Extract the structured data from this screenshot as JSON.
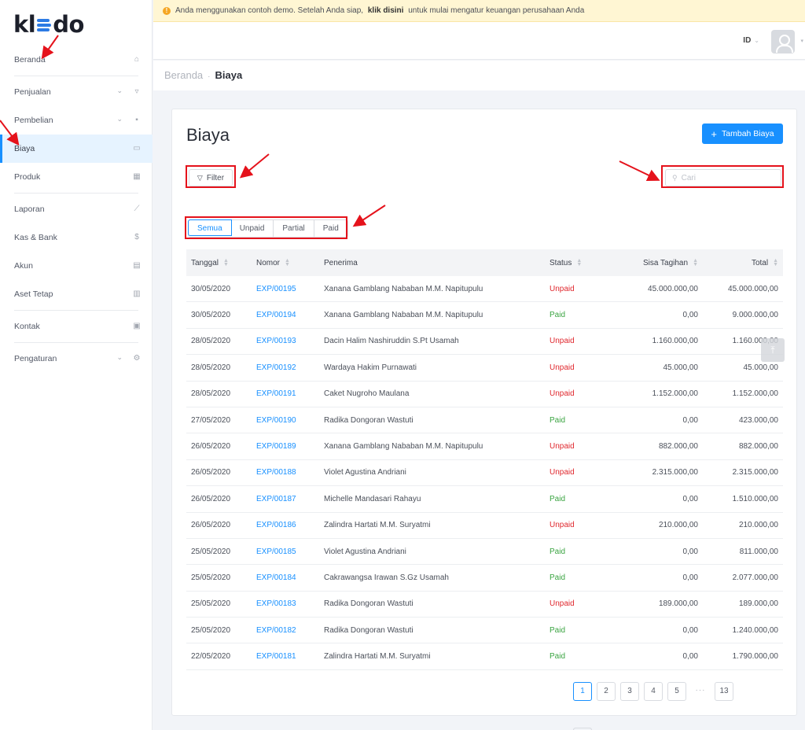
{
  "brand": {
    "logo_text_left": "kl",
    "logo_text_right": "do"
  },
  "banner": {
    "text_before": "Anda menggunakan contoh demo. Setelah Anda siap, ",
    "link_text": "klik disini",
    "text_after": " untuk mulai mengatur keuangan perusahaan Anda"
  },
  "header": {
    "language": "ID"
  },
  "sidebar": {
    "items": [
      {
        "label": "Beranda",
        "icon": "home-icon"
      },
      {
        "label": "Penjualan",
        "icon": "basket-icon"
      },
      {
        "label": "Pembelian",
        "icon": "bag-icon"
      },
      {
        "label": "Biaya",
        "icon": "card-icon"
      },
      {
        "label": "Produk",
        "icon": "boxes-icon"
      },
      {
        "label": "Laporan",
        "icon": "chart-icon"
      },
      {
        "label": "Kas & Bank",
        "icon": "dollar-icon"
      },
      {
        "label": "Akun",
        "icon": "ledger-icon"
      },
      {
        "label": "Aset Tetap",
        "icon": "building-icon"
      },
      {
        "label": "Kontak",
        "icon": "contact-card-icon"
      },
      {
        "label": "Pengaturan",
        "icon": "gears-icon"
      }
    ]
  },
  "breadcrumb": {
    "home": "Beranda",
    "current": "Biaya"
  },
  "page": {
    "title": "Biaya",
    "add_button": "Tambah Biaya",
    "filter_button": "Filter",
    "search_placeholder": "Cari"
  },
  "tabs": [
    "Semua",
    "Unpaid",
    "Partial",
    "Paid"
  ],
  "table": {
    "headers": [
      "Tanggal",
      "Nomor",
      "Penerima",
      "Status",
      "Sisa Tagihan",
      "Total"
    ],
    "rows": [
      [
        "30/05/2020",
        "EXP/00195",
        "Xanana Gamblang Nababan M.M. Napitupulu",
        "Unpaid",
        "45.000.000,00",
        "45.000.000,00"
      ],
      [
        "30/05/2020",
        "EXP/00194",
        "Xanana Gamblang Nababan M.M. Napitupulu",
        "Paid",
        "0,00",
        "9.000.000,00"
      ],
      [
        "28/05/2020",
        "EXP/00193",
        "Dacin Halim Nashiruddin S.Pt Usamah",
        "Unpaid",
        "1.160.000,00",
        "1.160.000,00"
      ],
      [
        "28/05/2020",
        "EXP/00192",
        "Wardaya Hakim Purnawati",
        "Unpaid",
        "45.000,00",
        "45.000,00"
      ],
      [
        "28/05/2020",
        "EXP/00191",
        "Caket Nugroho Maulana",
        "Unpaid",
        "1.152.000,00",
        "1.152.000,00"
      ],
      [
        "27/05/2020",
        "EXP/00190",
        "Radika Dongoran Wastuti",
        "Paid",
        "0,00",
        "423.000,00"
      ],
      [
        "26/05/2020",
        "EXP/00189",
        "Xanana Gamblang Nababan M.M. Napitupulu",
        "Unpaid",
        "882.000,00",
        "882.000,00"
      ],
      [
        "26/05/2020",
        "EXP/00188",
        "Violet Agustina Andriani",
        "Unpaid",
        "2.315.000,00",
        "2.315.000,00"
      ],
      [
        "26/05/2020",
        "EXP/00187",
        "Michelle Mandasari Rahayu",
        "Paid",
        "0,00",
        "1.510.000,00"
      ],
      [
        "26/05/2020",
        "EXP/00186",
        "Zalindra Hartati M.M. Suryatmi",
        "Unpaid",
        "210.000,00",
        "210.000,00"
      ],
      [
        "25/05/2020",
        "EXP/00185",
        "Violet Agustina Andriani",
        "Paid",
        "0,00",
        "811.000,00"
      ],
      [
        "25/05/2020",
        "EXP/00184",
        "Cakrawangsa Irawan S.Gz Usamah",
        "Paid",
        "0,00",
        "2.077.000,00"
      ],
      [
        "25/05/2020",
        "EXP/00183",
        "Radika Dongoran Wastuti",
        "Unpaid",
        "189.000,00",
        "189.000,00"
      ],
      [
        "25/05/2020",
        "EXP/00182",
        "Radika Dongoran Wastuti",
        "Paid",
        "0,00",
        "1.240.000,00"
      ],
      [
        "22/05/2020",
        "EXP/00181",
        "Zalindra Hartati M.M. Suryatmi",
        "Paid",
        "0,00",
        "1.790.000,00"
      ]
    ]
  },
  "pagination": {
    "pages": [
      "1",
      "2",
      "3",
      "4",
      "5"
    ],
    "ellipsis": "···",
    "last": "13",
    "current": "1"
  },
  "colors": {
    "accent": "#1890ff",
    "unpaid": "#e0282e",
    "paid": "#3aa441",
    "annotation": "#e5121b"
  }
}
